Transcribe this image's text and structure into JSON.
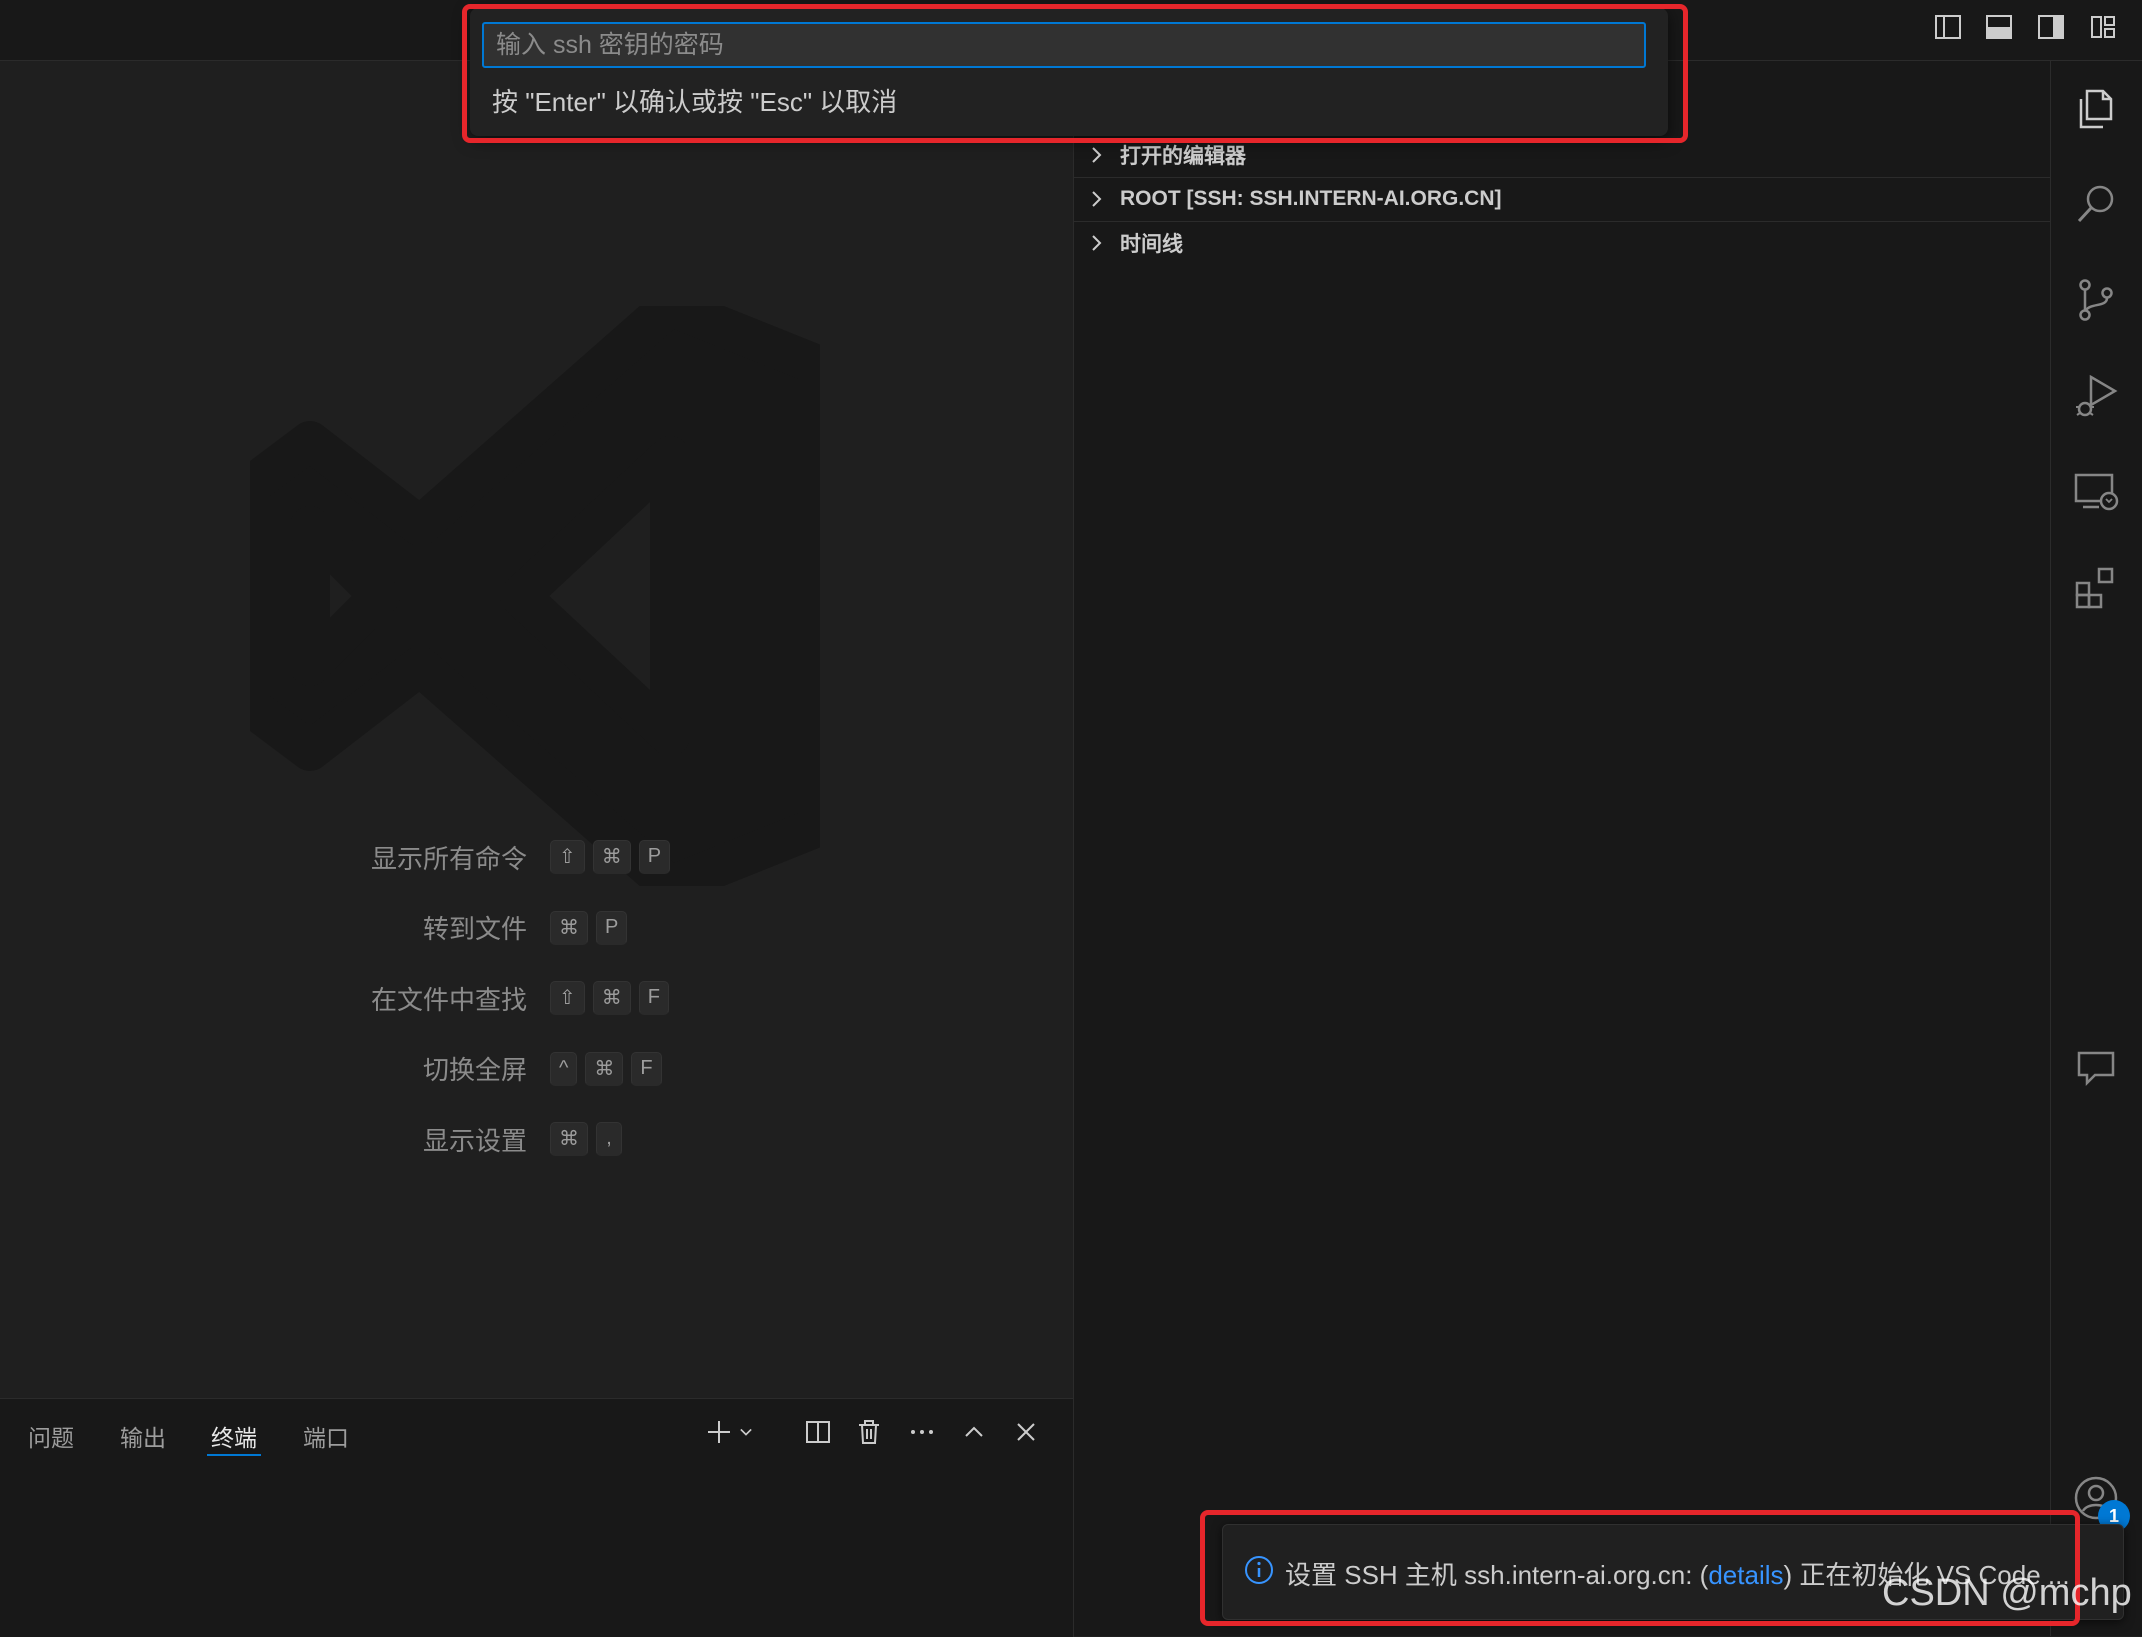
{
  "quick_input": {
    "placeholder": "输入 ssh 密钥的密码",
    "hint": "按 \"Enter\" 以确认或按 \"Esc\" 以取消"
  },
  "explorer": {
    "sections": [
      {
        "label": "打开的编辑器"
      },
      {
        "label": "ROOT [SSH: SSH.INTERN-AI.ORG.CN]"
      },
      {
        "label": "时间线"
      }
    ]
  },
  "editor": {
    "shortcuts": [
      {
        "label": "显示所有命令",
        "keys": [
          "⇧",
          "⌘",
          "P"
        ]
      },
      {
        "label": "转到文件",
        "keys": [
          "⌘",
          "P"
        ]
      },
      {
        "label": "在文件中查找",
        "keys": [
          "⇧",
          "⌘",
          "F"
        ]
      },
      {
        "label": "切换全屏",
        "keys": [
          "^",
          "⌘",
          "F"
        ]
      },
      {
        "label": "显示设置",
        "keys": [
          "⌘",
          ","
        ]
      }
    ]
  },
  "panel": {
    "tabs": [
      "问题",
      "输出",
      "终端",
      "端口"
    ],
    "active_tab": "终端"
  },
  "notification": {
    "prefix": "设置 SSH 主机 ssh.intern-ai.org.cn: (",
    "link": "details",
    "suffix": ") 正在初始化 VS Code ..."
  },
  "accounts_badge": "1",
  "watermark_text": "CSDN @mchp",
  "colors": {
    "accent": "#0078d4",
    "annotation_red": "#e6262b",
    "link": "#3794ff"
  },
  "icons": {
    "activity_bar": [
      "explorer-icon",
      "search-icon",
      "source-control-icon",
      "run-debug-icon",
      "remote-explorer-icon",
      "extensions-icon",
      "chat-icon",
      "accounts-icon"
    ],
    "layout": [
      "toggle-primary-sidebar-icon",
      "toggle-panel-icon",
      "toggle-secondary-sidebar-icon",
      "customize-layout-icon"
    ]
  }
}
